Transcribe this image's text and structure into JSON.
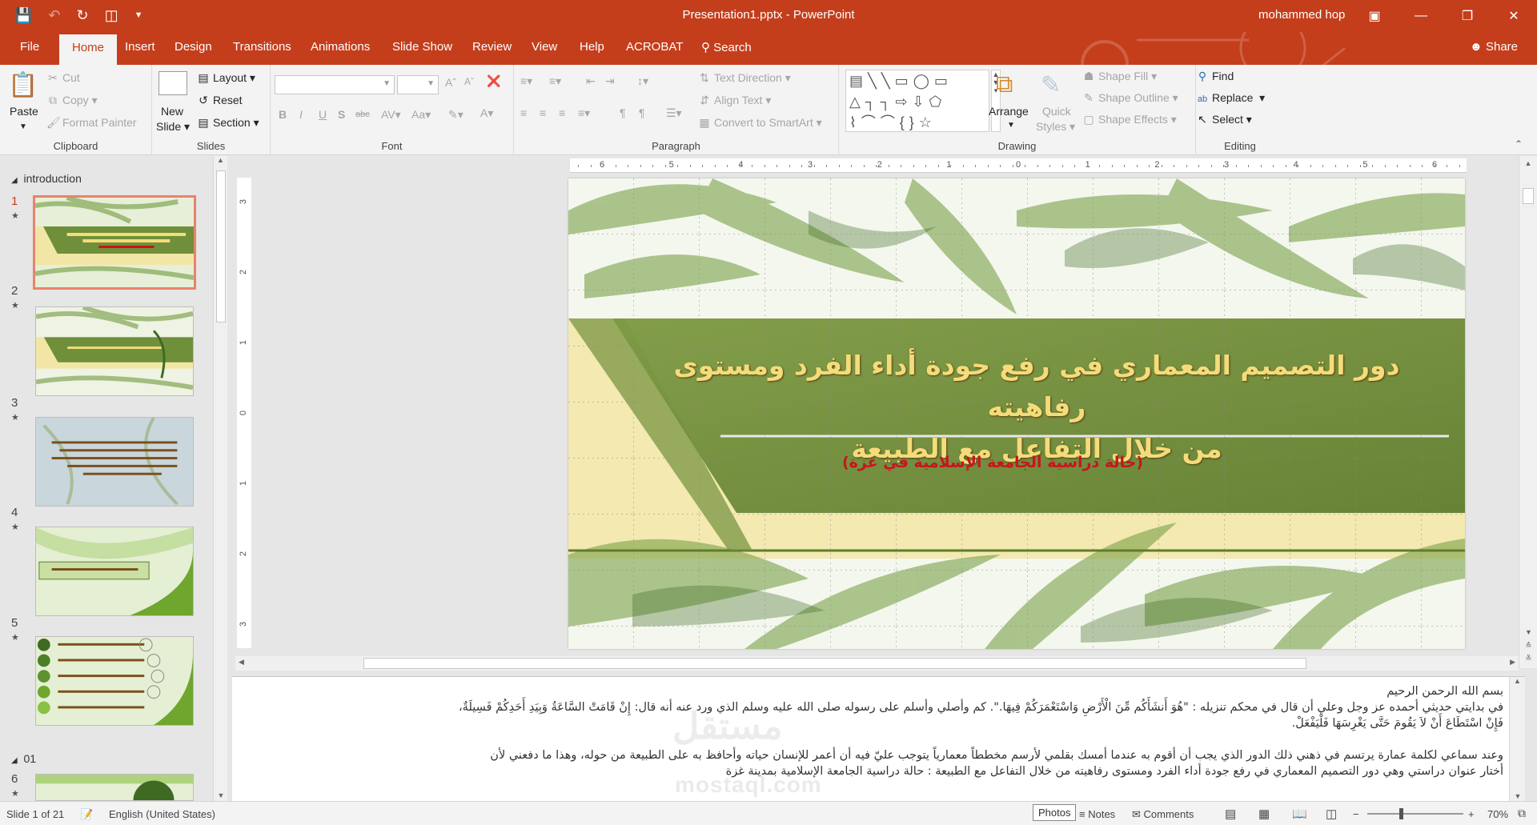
{
  "window": {
    "title": "Presentation1.pptx  -  PowerPoint",
    "user": "mohammed hop"
  },
  "tabs": [
    {
      "label": "File"
    },
    {
      "label": "Home"
    },
    {
      "label": "Insert"
    },
    {
      "label": "Design"
    },
    {
      "label": "Transitions"
    },
    {
      "label": "Animations"
    },
    {
      "label": "Slide Show"
    },
    {
      "label": "Review"
    },
    {
      "label": "View"
    },
    {
      "label": "Help"
    },
    {
      "label": "ACROBAT"
    }
  ],
  "search_label": "Search",
  "share_label": "Share",
  "ribbon": {
    "clipboard": {
      "label": "Clipboard",
      "paste": "Paste",
      "cut": "Cut",
      "copy": "Copy",
      "format_painter": "Format Painter"
    },
    "slides": {
      "label": "Slides",
      "new_slide_1": "New",
      "new_slide_2": "Slide",
      "layout": "Layout",
      "reset": "Reset",
      "section": "Section"
    },
    "font": {
      "label": "Font",
      "name_value": "",
      "size_value": ""
    },
    "paragraph": {
      "label": "Paragraph",
      "text_direction": "Text Direction",
      "align_text": "Align Text",
      "convert_smartart": "Convert to SmartArt"
    },
    "drawing": {
      "label": "Drawing",
      "arrange": "Arrange",
      "quick_styles_1": "Quick",
      "quick_styles_2": "Styles",
      "shape_fill": "Shape Fill",
      "shape_outline": "Shape Outline",
      "shape_effects": "Shape Effects"
    },
    "editing": {
      "label": "Editing",
      "find": "Find",
      "replace": "Replace",
      "select": "Select"
    }
  },
  "thumbnails": {
    "sections": [
      {
        "label": "introduction"
      },
      {
        "label": "01"
      }
    ],
    "slides": [
      {
        "num": "1"
      },
      {
        "num": "2"
      },
      {
        "num": "3"
      },
      {
        "num": "4"
      },
      {
        "num": "5"
      },
      {
        "num": "6"
      }
    ]
  },
  "slide": {
    "title_line1": "دور التصميم المعماري في رفع جودة أداء الفرد ومستوى رفاهيته",
    "title_line2": "من خلال التفاعل مع الطبيعة",
    "subtitle": "(حالة دراسية الجامعة الإسلامية في غزة)"
  },
  "notes": {
    "line1": "بسم الله الرحمن الرحيم",
    "line2": "في بدايتي حديثي أحمده عز وجل وعلي أن قال في محكم تنزيله : \"هُوَ أَنشَأَكُم مِّنَ الْأَرْضِ وَاسْتَعْمَرَكُمْ فِيهَا.\". كم وأصلي وأسلم على رسوله صلى الله عليه وسلم الذي ورد عنه أنه قال: إِنْ قَامَتْ السَّاعَةُ وَبِيَدِ أَحَدِكُمْ فَسِيلَةٌ،",
    "line3": "فَإِنْ اسْتَطَاعَ أَنْ لاَ يَقُومَ حَتَّى يَغْرِسَهَا فَلْيَفْعَلْ.",
    "line4": "وعند سماعي لكلمة عمارة يرتسم في ذهني ذلك الدور الذي يجب أن أقوم به عندما أمسك بقلمي لأرسم مخططاً معمارياً يتوجب عليّ فيه أن أعمر للإنسان حياته وأحافظ به على الطبيعة من حوله، وهذا ما دفعني لأن",
    "line5": "أختار عنوان دراستي وهي دور التصميم المعماري في رفع جودة أداء الفرد ومستوى رفاهيته  من خلال التفاعل مع الطبيعة : حالة دراسية الجامعة الإسلامية بمدينة غزة"
  },
  "watermark": {
    "arabic": "مستقل",
    "latin": "mostaql.com"
  },
  "status": {
    "slide_of": "Slide 1 of 21",
    "language": "English (United States)",
    "photos_tip": "Photos",
    "notes": "Notes",
    "comments": "Comments",
    "zoom": "70%"
  },
  "colors": {
    "accent": "#c43e1c",
    "slide_green": "#6f8f3a",
    "slide_yellow": "#f2e6a6"
  },
  "ruler": {
    "h_ticks": [
      "6",
      "5",
      "4",
      "3",
      "2",
      "1",
      "0",
      "1",
      "2",
      "3",
      "4",
      "5",
      "6"
    ],
    "v_ticks": [
      "3",
      "2",
      "1",
      "0",
      "1",
      "2",
      "3"
    ]
  }
}
